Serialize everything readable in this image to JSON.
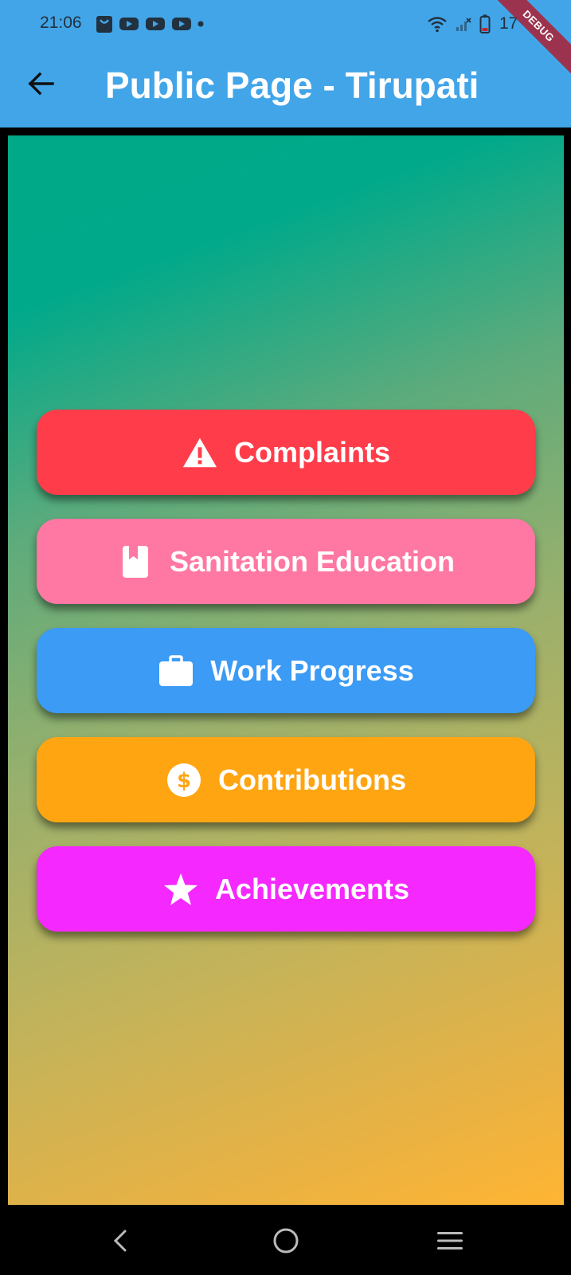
{
  "status_bar": {
    "time": "21:06",
    "notification_icons": [
      "bag-icon",
      "youtube-icon",
      "youtube-icon",
      "youtube-icon",
      "more-dot-icon"
    ],
    "battery_text": "17"
  },
  "debug_banner": "DEBUG",
  "app_bar": {
    "title": "Public Page - Tirupati",
    "background": "#42A5E8"
  },
  "menu": {
    "complaints": {
      "label": "Complaints",
      "icon": "warning-icon",
      "color": "#FF3D4A"
    },
    "sanitation_education": {
      "label": "Sanitation Education",
      "icon": "book-icon",
      "color": "#FF77A3"
    },
    "work_progress": {
      "label": "Work Progress",
      "icon": "briefcase-icon",
      "color": "#3B9BF5"
    },
    "contributions": {
      "label": "Contributions",
      "icon": "dollar-circle-icon",
      "color": "#FFA512"
    },
    "achievements": {
      "label": "Achievements",
      "icon": "star-icon",
      "color": "#F528FF"
    }
  },
  "nav_bar": {
    "items": [
      "back-icon",
      "home-icon",
      "menu-icon"
    ]
  }
}
